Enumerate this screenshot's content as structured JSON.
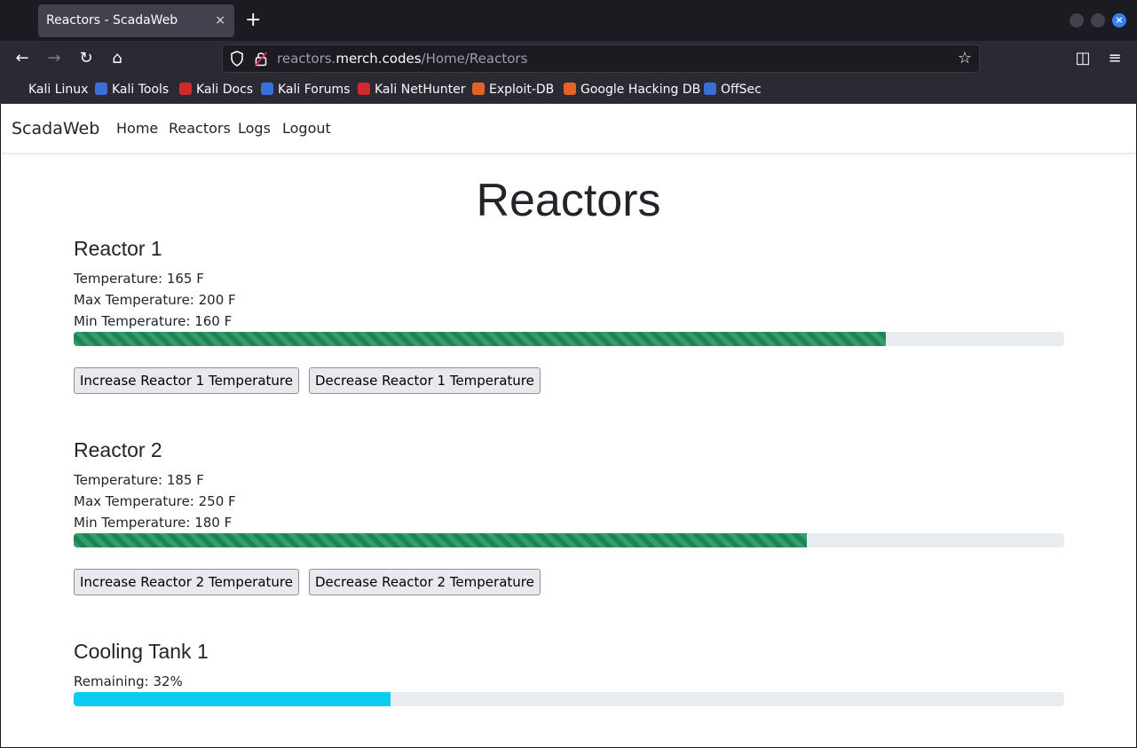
{
  "browser": {
    "tab_title": "Reactors - ScadaWeb",
    "tab_close": "×",
    "new_tab": "+",
    "window_close": "×",
    "url_host_prefix": "reactors.",
    "url_host": "merch.codes",
    "url_path": "/Home/Reactors",
    "icons": {
      "back": "←",
      "forward": "→",
      "reload": "↻",
      "home": "⌂",
      "star": "☆",
      "pocket": "◫",
      "menu": "≡"
    },
    "bookmarks": [
      {
        "label": "Kali Linux",
        "color": "#2b2a33"
      },
      {
        "label": "Kali Tools",
        "color": "#3a6fd8"
      },
      {
        "label": "Kali Docs",
        "color": "#cf2b2b"
      },
      {
        "label": "Kali Forums",
        "color": "#3a6fd8"
      },
      {
        "label": "Kali NetHunter",
        "color": "#cf2b2b"
      },
      {
        "label": "Exploit-DB",
        "color": "#e2622a"
      },
      {
        "label": "Google Hacking DB",
        "color": "#e2622a"
      },
      {
        "label": "OffSec",
        "color": "#3a6fd8"
      }
    ]
  },
  "site": {
    "brand": "ScadaWeb",
    "nav": [
      "Home",
      "Reactors",
      "Logs",
      "Logout"
    ]
  },
  "page": {
    "title": "Reactors",
    "reactors": [
      {
        "name": "Reactor 1",
        "temperature": "Temperature: 165 F",
        "max": "Max Temperature: 200 F",
        "min": "Min Temperature: 160 F",
        "level_percent": 82,
        "increase_label": "Increase Reactor 1 Temperature",
        "decrease_label": "Decrease Reactor 1 Temperature"
      },
      {
        "name": "Reactor 2",
        "temperature": "Temperature: 185 F",
        "max": "Max Temperature: 250 F",
        "min": "Min Temperature: 180 F",
        "level_percent": 74,
        "increase_label": "Increase Reactor 2 Temperature",
        "decrease_label": "Decrease Reactor 2 Temperature"
      }
    ],
    "cooling_tank": {
      "name": "Cooling Tank 1",
      "remaining": "Remaining: 32%",
      "level_percent": 32
    }
  },
  "colors": {
    "reactor_bar": "#198754",
    "cooling_bar": "#0dcaf0",
    "track": "#e9ecef"
  }
}
